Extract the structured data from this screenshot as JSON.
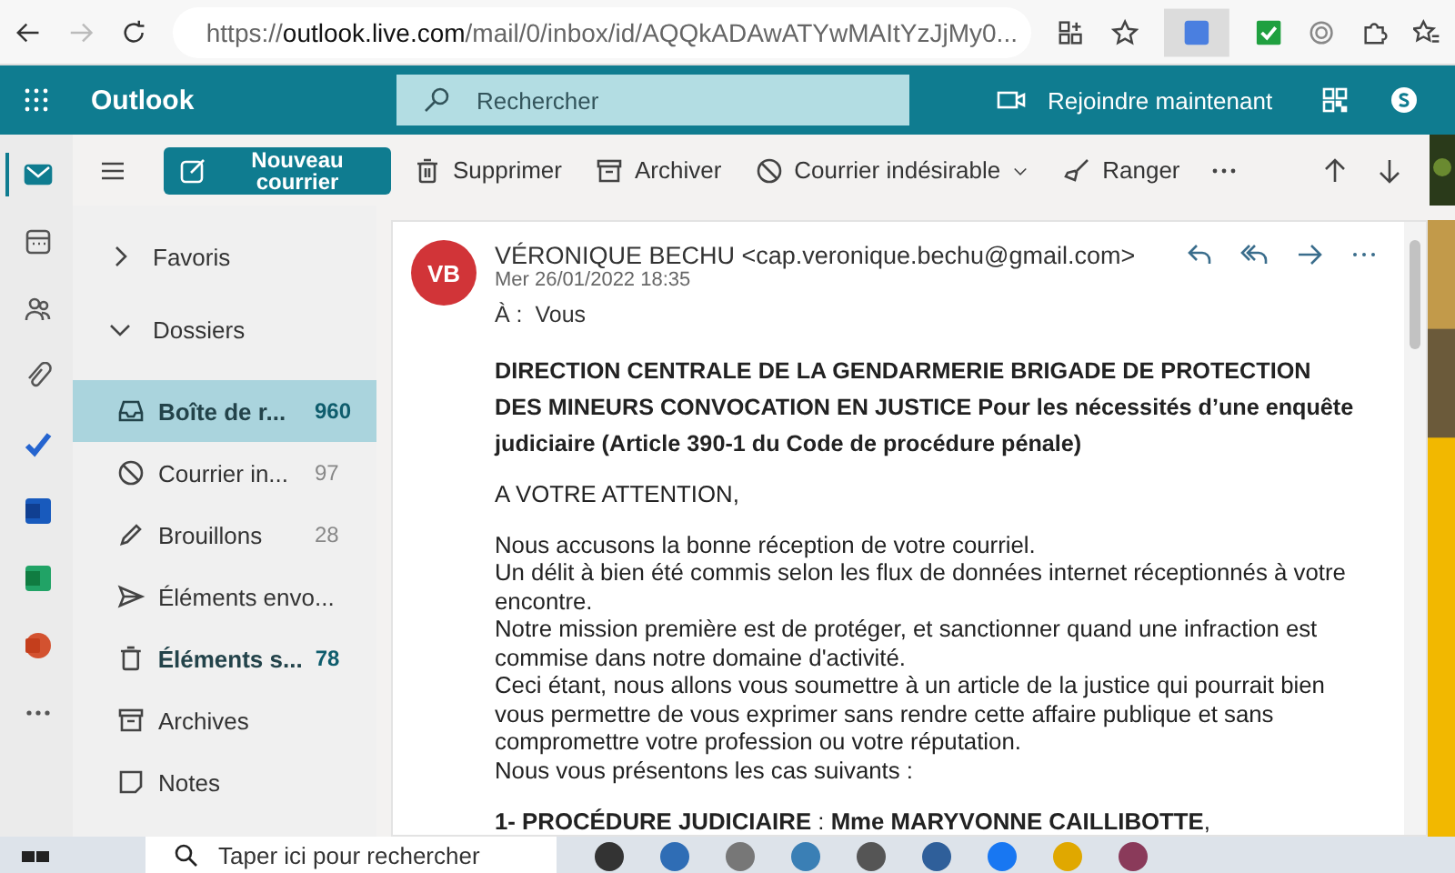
{
  "browser": {
    "url_scheme": "https://",
    "url_host": "outlook.live.com",
    "url_path": "/mail/0/inbox/id/AQQkADAwATYwMAItYzJjMy0..."
  },
  "header": {
    "app_name": "Outlook",
    "search_placeholder": "Rechercher",
    "join_label": "Rejoindre maintenant"
  },
  "rail": [
    {
      "kind": "mail",
      "selected": true
    },
    {
      "kind": "calendar",
      "selected": false
    },
    {
      "kind": "people",
      "selected": false
    },
    {
      "kind": "attach",
      "selected": false
    },
    {
      "kind": "todo",
      "selected": false
    },
    {
      "kind": "word",
      "selected": false
    },
    {
      "kind": "excel",
      "selected": false
    },
    {
      "kind": "powerpoint",
      "selected": false
    },
    {
      "kind": "more",
      "selected": false
    }
  ],
  "toolbar": {
    "new_mail": "Nouveau courrier",
    "actions": [
      {
        "kind": "delete",
        "label": "Supprimer"
      },
      {
        "kind": "archive",
        "label": "Archiver"
      },
      {
        "kind": "junk",
        "label": "Courrier indésirable",
        "dropdown": true
      },
      {
        "kind": "sweep",
        "label": "Ranger"
      }
    ]
  },
  "folders": {
    "sections": [
      {
        "label": "Favoris",
        "expanded": false
      },
      {
        "label": "Dossiers",
        "expanded": true
      }
    ],
    "items": [
      {
        "kind": "inbox",
        "label": "Boîte de r...",
        "count": "960",
        "unread": true,
        "selected": true
      },
      {
        "kind": "junk",
        "label": "Courrier in...",
        "count": "97",
        "unread": false,
        "selected": false
      },
      {
        "kind": "drafts",
        "label": "Brouillons",
        "count": "28",
        "unread": false,
        "selected": false
      },
      {
        "kind": "sent",
        "label": "Éléments envo...",
        "selected": false
      },
      {
        "kind": "deleted",
        "label": "Éléments s...",
        "count": "78",
        "unread": true,
        "selected": false
      },
      {
        "kind": "archive",
        "label": "Archives",
        "selected": false
      },
      {
        "kind": "notes",
        "label": "Notes",
        "selected": false
      }
    ]
  },
  "message": {
    "initials": "VB",
    "sender": "VÉRONIQUE BECHU <cap.veronique.bechu@gmail.com>",
    "date": "Mer 26/01/2022 18:35",
    "to_label": "À :",
    "to": "Vous",
    "subject": "DIRECTION CENTRALE DE LA GENDARMERIE BRIGADE DE PROTECTION DES MINEURS CONVOCATION EN JUSTICE Pour les nécessités d’une enquête judiciaire (Article 390-1 du Code de procédure pénale)",
    "greeting": "A VOTRE ATTENTION,",
    "lines": [
      "Nous accusons la bonne réception de votre courriel.",
      "Un délit à bien été commis selon les flux de données internet réceptionnés à votre encontre.",
      "Notre mission première est de protéger, et sanctionner quand une infraction est commise dans notre domaine d'activité.",
      "Ceci étant, nous allons vous soumettre à un article de la justice qui pourrait bien vous permettre de vous exprimer sans rendre cette affaire publique et sans compromettre votre profession ou votre réputation.",
      "Nous vous présentons les cas suivants :"
    ],
    "section": "**1- PROCÉDURE JUDICIAIRE** : **Mme MARYVONNE CAILLIBOTTE**,"
  },
  "taskbar": {
    "search_placeholder": "Taper ici pour rechercher"
  }
}
